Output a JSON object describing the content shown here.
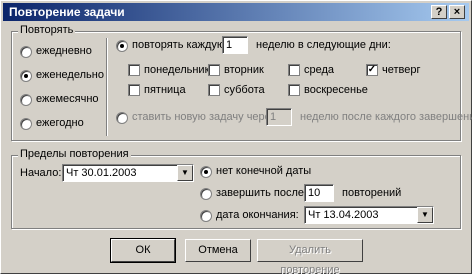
{
  "window": {
    "title": "Повторение задачи",
    "help_label": "?",
    "close_label": "×"
  },
  "repeat_group": {
    "legend": "Повторять",
    "options": [
      "ежедневно",
      "еженедельно",
      "ежемесячно",
      "ежегодно"
    ],
    "selected": "еженедельно",
    "every": {
      "label_pre": "повторять каждую",
      "value": "1",
      "label_post": "неделю в следующие дни:"
    },
    "days": [
      {
        "label": "понедельник",
        "checked": false
      },
      {
        "label": "вторник",
        "checked": false
      },
      {
        "label": "среда",
        "checked": false
      },
      {
        "label": "четверг",
        "checked": true
      },
      {
        "label": "пятница",
        "checked": false
      },
      {
        "label": "суббота",
        "checked": false
      },
      {
        "label": "воскресенье",
        "checked": false
      }
    ],
    "regen": {
      "label_pre": "ставить новую задачу через",
      "value": "1",
      "label_post": "неделю после каждого завершения"
    }
  },
  "range_group": {
    "legend": "Пределы повторения",
    "start_label": "Начало:",
    "start_value": "Чт 30.01.2003",
    "no_end_label": "нет конечной даты",
    "end_after_label": "завершить после:",
    "end_after_value": "10",
    "end_after_suffix": "повторений",
    "end_by_label": "дата окончания:",
    "end_by_value": "Чт 13.04.2003"
  },
  "buttons": {
    "ok": "ОК",
    "cancel": "Отмена",
    "remove": "Удалить повторение"
  }
}
